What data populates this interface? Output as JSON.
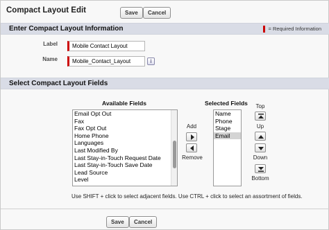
{
  "header": {
    "title": "Compact Layout Edit",
    "save_label": "Save",
    "cancel_label": "Cancel"
  },
  "info_section": {
    "title": "Enter Compact Layout Information",
    "required_note": "= Required Information",
    "label_caption": "Label",
    "label_value": "Mobile Contact Layout",
    "name_caption": "Name",
    "name_value": "Mobile_Contact_Layout",
    "info_icon": "i"
  },
  "fields_section": {
    "title": "Select Compact Layout Fields",
    "available_header": "Available Fields",
    "selected_header": "Selected Fields",
    "available_items": [
      "Email Opt Out",
      "Fax",
      "Fax Opt Out",
      "Home Phone",
      "Languages",
      "Last Modified By",
      "Last Stay-in-Touch Request Date",
      "Last Stay-in-Touch Save Date",
      "Lead Source",
      "Level"
    ],
    "selected_items": [
      "Name",
      "Phone",
      "Stage",
      "Email"
    ],
    "selected_highlight": "Email",
    "add_label": "Add",
    "remove_label": "Remove",
    "top_label": "Top",
    "up_label": "Up",
    "down_label": "Down",
    "bottom_label": "Bottom",
    "hint": "Use SHIFT + click to select adjacent fields. Use CTRL + click to select an assortment of fields."
  },
  "footer": {
    "save_label": "Save",
    "cancel_label": "Cancel"
  },
  "colors": {
    "required": "#cc0000",
    "section_bg": "#d9dce6"
  }
}
